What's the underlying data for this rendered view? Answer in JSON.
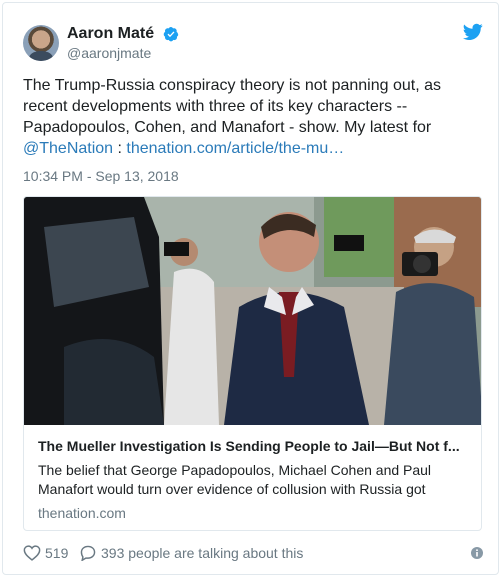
{
  "user": {
    "name": "Aaron Maté",
    "handle": "@aaronjmate"
  },
  "tweet": {
    "text": "The Trump-Russia conspiracy theory is not panning out, as recent developments with three of its key characters -- Papadopoulos, Cohen, and Manafort - show. My latest for ",
    "mention": "@TheNation",
    "separator": " : ",
    "link": "thenation.com/article/the-mu…",
    "timestamp": "10:34 PM - Sep 13, 2018"
  },
  "card": {
    "title": "The Mueller Investigation Is Sending People to Jail—But Not f...",
    "description": "The belief that George Papadopoulos, Michael Cohen and Paul Manafort would turn over evidence of collusion with Russia got",
    "domain": "thenation.com"
  },
  "footer": {
    "likes": "519",
    "talking": "393 people are talking about this"
  },
  "colors": {
    "link": "#2b7bb9",
    "twitter_blue": "#1da1f2",
    "muted": "#697882"
  },
  "icons": [
    "verified-icon",
    "twitter-bird-icon",
    "heart-icon",
    "comment-icon",
    "info-icon"
  ]
}
